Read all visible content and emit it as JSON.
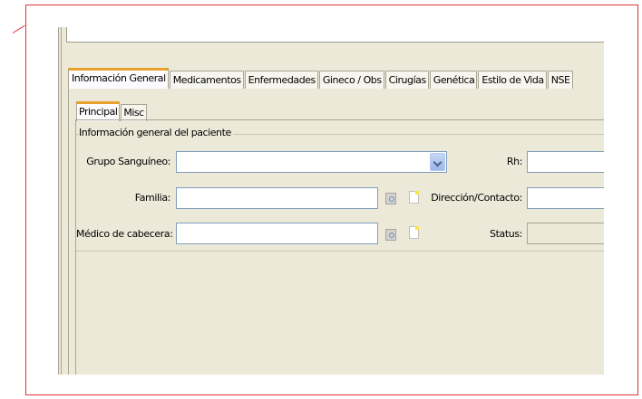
{
  "main_tabs": [
    {
      "label": "Información General",
      "active": true
    },
    {
      "label": "Medicamentos",
      "active": false
    },
    {
      "label": "Enfermedades",
      "active": false
    },
    {
      "label": "Gineco / Obs",
      "active": false
    },
    {
      "label": "Cirugías",
      "active": false
    },
    {
      "label": "Genética",
      "active": false
    },
    {
      "label": "Estilo de Vida",
      "active": false
    },
    {
      "label": "NSE",
      "active": false
    }
  ],
  "sub_tabs": [
    {
      "label": "Principal",
      "active": true
    },
    {
      "label": "Misc",
      "active": false
    }
  ],
  "group_title": "Información general del paciente",
  "fields": {
    "grupo_sanguineo": {
      "label": "Grupo Sanguíneo:",
      "value": ""
    },
    "rh": {
      "label": "Rh:",
      "value": ""
    },
    "familia": {
      "label": "Familia:",
      "value": ""
    },
    "direccion": {
      "label": "Dirección/Contacto:",
      "value": ""
    },
    "medico": {
      "label": "Médico de cabecera:",
      "value": ""
    },
    "status": {
      "label": "Status:",
      "value": ""
    }
  },
  "icons": {
    "search": "search-icon",
    "note": "note-icon",
    "dropdown": "chevron-down-icon"
  },
  "colors": {
    "accent_tab": "#e8a12a",
    "frame_border": "#e0343a",
    "panel_bg": "#ece9d8",
    "input_border": "#7f9db9"
  }
}
